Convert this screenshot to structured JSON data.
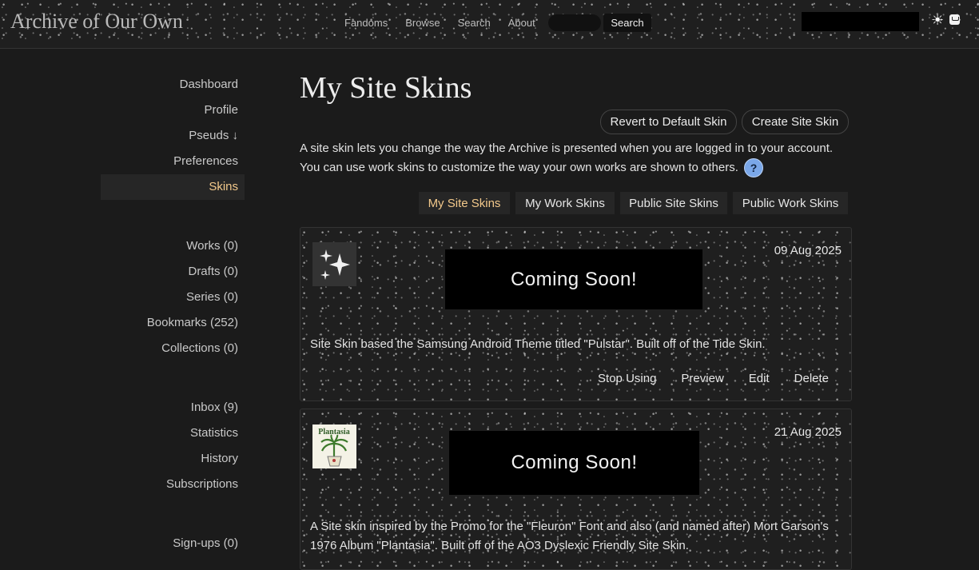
{
  "header": {
    "logo": "Archive of Our Own",
    "nav": [
      "Fandoms",
      "Browse",
      "Search",
      "About"
    ],
    "search_button": "Search",
    "theme_icon": "sun-icon",
    "inbox_icon": "message-icon"
  },
  "sidebar": {
    "group1": [
      "Dashboard",
      "Profile",
      "Pseuds ↓",
      "Preferences",
      "Skins"
    ],
    "group2": [
      "Works (0)",
      "Drafts (0)",
      "Series (0)",
      "Bookmarks (252)",
      "Collections (0)"
    ],
    "group3": [
      "Inbox (9)",
      "Statistics",
      "History",
      "Subscriptions"
    ],
    "group4": [
      "Sign-ups (0)"
    ],
    "active": "Skins"
  },
  "main": {
    "title": "My Site Skins",
    "revert_button": "Revert to Default Skin",
    "create_button": "Create Site Skin",
    "intro_line1": "A site skin lets you change the way the Archive is presented when you are logged in to your account.",
    "intro_line2": "You can use work skins to customize the way your own works are shown to others.",
    "help_label": "?",
    "tabs": [
      "My Site Skins",
      "My Work Skins",
      "Public Site Skins",
      "Public Work Skins"
    ]
  },
  "skins": [
    {
      "icon": "sparkles-icon",
      "preview": "Coming Soon!",
      "date": "09 Aug 2025",
      "description": "Site Skin based the Samsung Android Theme titled \"Pulstar\". Built off of the Tide Skin.",
      "actions": [
        "Stop Using",
        "Preview",
        "Edit",
        "Delete"
      ]
    },
    {
      "icon": "album-cover-icon",
      "icon_text": "Plantasia",
      "preview": "Coming Soon!",
      "date": "21 Aug 2025",
      "description": "A Site skin inspired by the Promo for the \"Fleuron\" Font and also (and named after) Mort Garson's 1976 Album \"Plantasia\". Built off of the AO3 Dyslexic Friendly Site Skin."
    }
  ],
  "colors": {
    "background": "#1b1b1b",
    "accent": "#f3c98b",
    "help": "#7aa7e8"
  }
}
